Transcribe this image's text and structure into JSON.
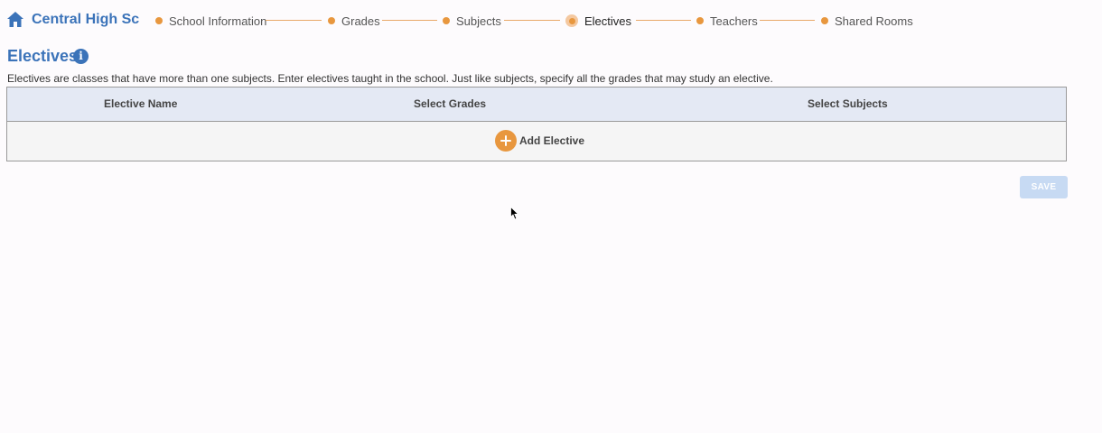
{
  "header": {
    "school_name": "Central High Sc",
    "home_icon": "home-icon"
  },
  "stepper": {
    "steps": [
      {
        "label": "School Information",
        "active": false
      },
      {
        "label": "Grades",
        "active": false
      },
      {
        "label": "Subjects",
        "active": false
      },
      {
        "label": "Electives",
        "active": true
      },
      {
        "label": "Teachers",
        "active": false
      },
      {
        "label": "Shared Rooms",
        "active": false
      }
    ]
  },
  "section": {
    "title": "Electives",
    "info_icon": "info-icon",
    "info_glyph": "i",
    "description": "Electives are classes that have more than one subjects. Enter electives taught in the school. Just like subjects, specify all the grades that may study an elective."
  },
  "table": {
    "columns": [
      "Elective Name",
      "Select Grades",
      "Select Subjects"
    ],
    "rows": [],
    "add_label": "Add Elective"
  },
  "actions": {
    "save_label": "SAVE",
    "save_enabled": false
  },
  "colors": {
    "brand_blue": "#3b73b9",
    "accent_orange": "#e8973e",
    "header_bg": "#e4e9f4",
    "save_disabled_bg": "#c7daf3"
  }
}
